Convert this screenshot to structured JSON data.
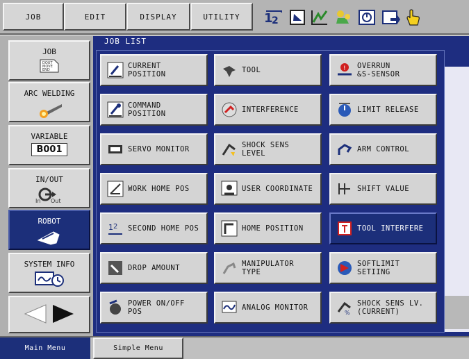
{
  "top_menu": {
    "job": "JOB",
    "edit": "EDIT",
    "display": "DISPLAY",
    "utility": "UTILITY",
    "status_icons": [
      "coordinate-12-icon",
      "manual-speed-icon",
      "chart-icon",
      "robot-status-icon",
      "servo-icon",
      "job-icon",
      "hand-pointer-icon"
    ]
  },
  "left_menu": {
    "job": {
      "label": "JOB",
      "icon_text": "DOUT\nMOVE\nEND"
    },
    "arc_welding": {
      "label": "ARC WELDING"
    },
    "variable": {
      "label": "VARIABLE",
      "value": "B001"
    },
    "in_out": {
      "label": "IN/OUT",
      "in": "In",
      "out": "Out"
    },
    "robot": {
      "label": "ROBOT"
    },
    "system_info": {
      "label": "SYSTEM INFO"
    }
  },
  "main": {
    "list_title": "JOB LIST",
    "items": [
      {
        "label": "CURRENT\n POSITION",
        "icon": "current-position-icon"
      },
      {
        "label": "TOOL",
        "icon": "tool-icon"
      },
      {
        "label": "OVERRUN\n &S-SENSOR",
        "icon": "overrun-icon"
      },
      {
        "label": "COMMAND\n POSITION",
        "icon": "command-position-icon"
      },
      {
        "label": "INTERFERENCE",
        "icon": "interference-icon"
      },
      {
        "label": "LIMIT RELEASE",
        "icon": "limit-release-icon"
      },
      {
        "label": "SERVO MONITOR",
        "icon": "servo-monitor-icon"
      },
      {
        "label": "SHOCK SENS\n  LEVEL",
        "icon": "shock-sens-icon"
      },
      {
        "label": "ARM CONTROL",
        "icon": "arm-control-icon"
      },
      {
        "label": "WORK HOME POS",
        "icon": "work-home-icon"
      },
      {
        "label": "USER COORDINATE",
        "icon": "user-coordinate-icon"
      },
      {
        "label": "SHIFT VALUE",
        "icon": "shift-value-icon"
      },
      {
        "label": "SECOND HOME POS",
        "icon": "second-home-icon"
      },
      {
        "label": "HOME POSITION",
        "icon": "home-position-icon"
      },
      {
        "label": "TOOL INTERFERE",
        "icon": "tool-interfere-icon",
        "selected": true
      },
      {
        "label": "DROP AMOUNT",
        "icon": "drop-amount-icon"
      },
      {
        "label": "MANIPULATOR\n  TYPE",
        "icon": "manipulator-type-icon"
      },
      {
        "label": "SOFTLIMIT\n SETIING",
        "icon": "softlimit-icon"
      },
      {
        "label": "POWER ON/OFF\n POS",
        "icon": "power-on-off-icon"
      },
      {
        "label": "ANALOG MONITOR",
        "icon": "analog-monitor-icon"
      },
      {
        "label": "SHOCK SENS LV.\n(CURRENT)",
        "icon": "shock-sens-current-icon"
      }
    ]
  },
  "bottom": {
    "main_menu": "Main Menu",
    "simple_menu": "Simple Menu"
  },
  "colors": {
    "accent": "#1c2f7a",
    "button": "#d4d4d4"
  }
}
